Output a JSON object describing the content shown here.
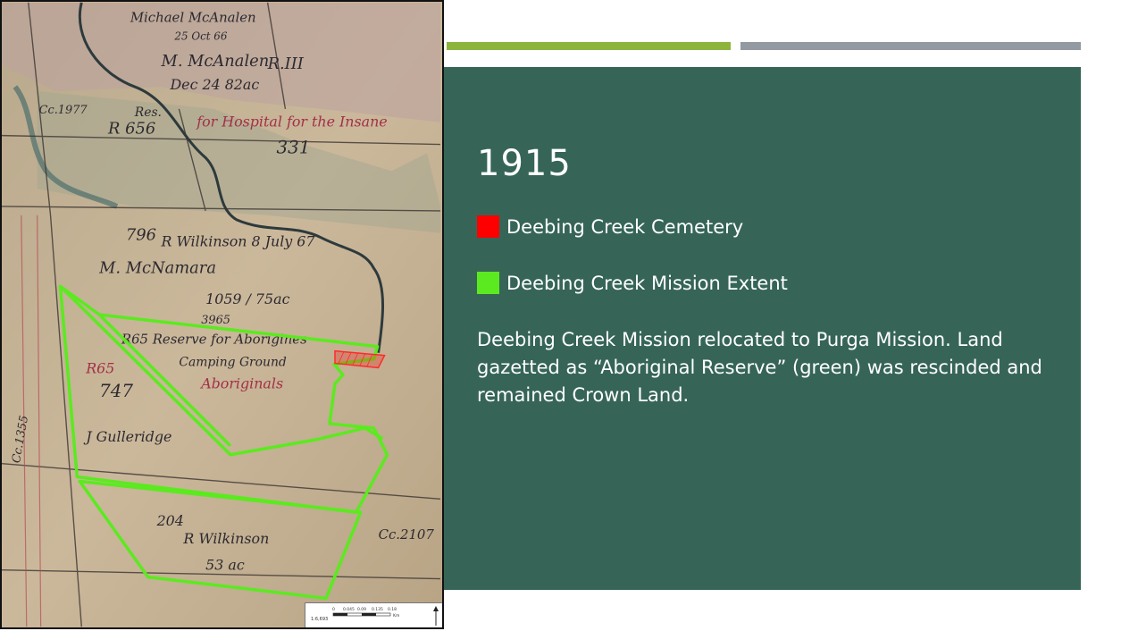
{
  "slide": {
    "title": "1915",
    "legend": [
      {
        "label": "Deebing Creek Cemetery",
        "color": "#ff0000"
      },
      {
        "label": "Deebing Creek Mission Extent",
        "color": "#5bea1f"
      }
    ],
    "description": "Deebing Creek Mission relocated to Purga Mission. Land gazetted as “Aboriginal Reserve” (green) was rescinded and remained Crown Land."
  },
  "map": {
    "labels": [
      "Michael McAnalen",
      "25 Oct 66",
      "M. McAnalen",
      "Dec 24 82ac",
      "R.III",
      "R 656",
      "Res.",
      "for Hospital for the Insane",
      "331",
      "796",
      "R Wilkinson 8 July 67",
      "M. McNamara",
      "1059 / 75ac",
      "3965",
      "R65 Reserve for Aborigines",
      "Camping Ground",
      "Aboriginals",
      "747",
      "J Gulleridge",
      "R65",
      "204",
      "R Wilkinson",
      "53 ac",
      "Cc.2107",
      "Cc.1977",
      "Cc.1355"
    ],
    "scale_ratio": "1:6,693",
    "scale_ticks": [
      "0",
      "0.045",
      "0.09",
      "0.135",
      "0.18"
    ],
    "scale_unit": "Km",
    "north_arrow": "north-arrow-icon"
  },
  "colors": {
    "panel": "#366558",
    "accent_green": "#8db53c",
    "accent_gray": "#939aa1",
    "mission_outline": "#5bea1f",
    "cemetery": "#ff0000"
  }
}
